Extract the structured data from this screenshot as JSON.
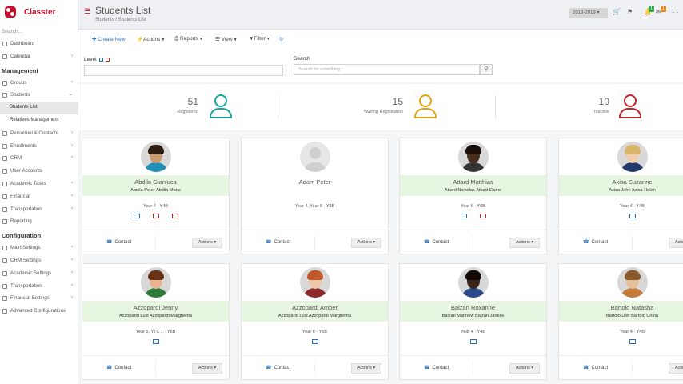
{
  "app": {
    "brand": "Classter"
  },
  "sidebar": {
    "search_label": "Search...",
    "top_items": [
      {
        "label": "Dashboard",
        "chevron": false
      },
      {
        "label": "Calendar",
        "chevron": true
      }
    ],
    "management_label": "Management",
    "management_items": [
      {
        "label": "Groups",
        "chevron": true
      },
      {
        "label": "Students",
        "chevron": true,
        "expanded": true
      }
    ],
    "student_sub": [
      {
        "label": "Students List",
        "active": true
      },
      {
        "label": "Relatives Management",
        "active": false
      }
    ],
    "management_items_2": [
      {
        "label": "Personnel & Contacts",
        "chevron": true
      },
      {
        "label": "Enrollments",
        "chevron": true
      },
      {
        "label": "CRM",
        "chevron": true
      },
      {
        "label": "User Accounts",
        "chevron": false
      },
      {
        "label": "Academic Tasks",
        "chevron": true
      },
      {
        "label": "Financial",
        "chevron": true
      },
      {
        "label": "Transportation",
        "chevron": true
      },
      {
        "label": "Reporting",
        "chevron": false
      }
    ],
    "configuration_label": "Configuration",
    "configuration_items": [
      {
        "label": "Main Settings",
        "chevron": true
      },
      {
        "label": "CRM Settings",
        "chevron": true
      },
      {
        "label": "Academic Settings",
        "chevron": true
      },
      {
        "label": "Transportation",
        "chevron": true
      },
      {
        "label": "Financial Settings",
        "chevron": true
      },
      {
        "label": "Advanced Configurations",
        "chevron": false
      }
    ]
  },
  "header": {
    "title": "Students List",
    "breadcrumb": "Students  /  Students List",
    "year": "2018-2019 ▾",
    "badges": {
      "notifications": "1",
      "messages": "1"
    },
    "user": "1 1"
  },
  "toolbar": {
    "create": "Create New",
    "actions": "Actions",
    "reports": "Reports",
    "view": "View",
    "filter": "Filter"
  },
  "filters": {
    "level_label": "Level",
    "search_label": "Search",
    "search_placeholder": "Search for something"
  },
  "stats": [
    {
      "count": "51",
      "label": "Registered",
      "color": "#1aa39a"
    },
    {
      "count": "15",
      "label": "Waiting Registration",
      "color": "#e0a419"
    },
    {
      "count": "10",
      "label": "Inactive",
      "color": "#c0282e"
    }
  ],
  "cards": [
    {
      "name": "Abdila Gianluca",
      "full": "Abdila Peter Abdila Maria",
      "year": "Year 4  ·  Y4B",
      "icons": [
        "#2a6fb5",
        "#c0282e",
        "#c0282e"
      ],
      "band": true,
      "skin": "#c99a6e",
      "hair": "#2e1e12",
      "shirt": "#1f8fb5"
    },
    {
      "name": "Adam Peter",
      "full": "",
      "year": "Year 4, Year 5  ·  Y3B",
      "icons": [],
      "band": false,
      "placeholder": true
    },
    {
      "name": "Attard Matthias",
      "full": "Attard Nicholas Attard Elaine",
      "year": "Year 6  ·  Y6B",
      "icons": [
        "#2a6fb5",
        "#c0282e"
      ],
      "band": true,
      "skin": "#4a2d1c",
      "hair": "#1a0e08",
      "shirt": "#333333"
    },
    {
      "name": "Axisa Suzanne",
      "full": "Axisa John Axisa Helen",
      "year": "Year 4  ·  Y4B",
      "icons": [
        "#2a6fb5"
      ],
      "band": true,
      "skin": "#f0cfb0",
      "hair": "#d9b56a",
      "shirt": "#223a6a"
    },
    {
      "name": "Azzopardi Jenny",
      "full": "Azzopardi Luis Azzopardi Margherita",
      "year": "Year 5, YTC 1  ·  Y6B",
      "icons": [
        "#2a6fb5"
      ],
      "band": true,
      "skin": "#e8b594",
      "hair": "#6a3418",
      "shirt": "#2f7a3a"
    },
    {
      "name": "Azzopardi Amber",
      "full": "Azzopardi Luis Azzopardi Margherita",
      "year": "Year 6  ·  Y6B",
      "icons": [
        "#2a6fb5"
      ],
      "band": true,
      "skin": "#efc7a8",
      "hair": "#c05a2a",
      "shirt": "#8a2a2a"
    },
    {
      "name": "Balzan Roxanne",
      "full": "Balzan Matthew Balzan Janelle",
      "year": "Year 4  ·  Y4B",
      "icons": [
        "#2a6fb5"
      ],
      "band": true,
      "skin": "#3a2416",
      "hair": "#120a06",
      "shirt": "#2a4a8a"
    },
    {
      "name": "Bartolo Natasha",
      "full": "Bartolo Don Bartolo Crista",
      "year": "Year 4  ·  Y4B",
      "icons": [
        "#2a6fb5"
      ],
      "band": true,
      "skin": "#e6c09a",
      "hair": "#8a5a2a",
      "shirt": "#c47a3a"
    }
  ],
  "card_labels": {
    "contact": "Contact",
    "actions": "Actions ▾"
  }
}
